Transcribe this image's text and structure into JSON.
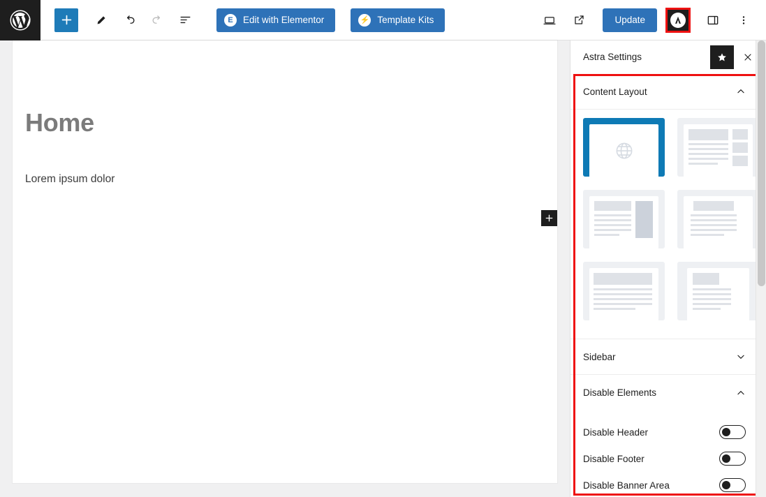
{
  "toolbar": {
    "logo_icon": "wordpress-logo-icon",
    "left_buttons": [
      {
        "name": "add-block-button",
        "icon": "plus-icon",
        "label": ""
      },
      {
        "name": "edit-tool-button",
        "icon": "pencil-icon",
        "label": ""
      },
      {
        "name": "undo-button",
        "icon": "undo-arrow-icon",
        "label": ""
      },
      {
        "name": "redo-button",
        "icon": "redo-arrow-icon",
        "label": ""
      },
      {
        "name": "document-overview-button",
        "icon": "list-view-icon",
        "label": ""
      }
    ],
    "elementor_label": "Edit with Elementor",
    "elementor_icon": "elementor-logo-icon",
    "template_kits_label": "Template Kits",
    "template_kits_icon": "lightning-bolt-icon",
    "preview_icon": "desktop-preview-icon",
    "view_icon": "external-link-icon",
    "update_label": "Update",
    "astra_icon": "astra-logo-icon",
    "sidebar_icon": "settings-sidebar-icon",
    "more_icon": "three-dots-vertical-icon"
  },
  "editor": {
    "post_title": "Home",
    "paragraph": "Lorem ipsum dolor",
    "appender_icon": "plus-icon"
  },
  "panel": {
    "title": "Astra Settings",
    "star_icon": "star-icon",
    "close_icon": "close-x-icon",
    "sections": {
      "content_layout": {
        "label": "Content Layout",
        "expanded": true,
        "chevron": "chevron-up-icon",
        "options": [
          {
            "name": "layout-default",
            "selected": true,
            "thumb": "globe"
          },
          {
            "name": "layout-narrow-sidebar-right-blocks",
            "selected": false,
            "thumb": "right-blocks"
          },
          {
            "name": "layout-content-with-right-sidebar",
            "selected": false,
            "thumb": "right-sidebar"
          },
          {
            "name": "layout-narrow-content",
            "selected": false,
            "thumb": "narrow-content"
          },
          {
            "name": "layout-full-width-contained",
            "selected": false,
            "thumb": "full-contained"
          },
          {
            "name": "layout-full-width-stretched",
            "selected": false,
            "thumb": "full-stretched"
          }
        ]
      },
      "sidebar": {
        "label": "Sidebar",
        "expanded": false,
        "chevron": "chevron-down-icon"
      },
      "disable_elements": {
        "label": "Disable Elements",
        "expanded": true,
        "chevron": "chevron-up-icon",
        "toggles": [
          {
            "label": "Disable Header",
            "name": "toggle-disable-header",
            "on": false
          },
          {
            "label": "Disable Footer",
            "name": "toggle-disable-footer",
            "on": false
          },
          {
            "label": "Disable Banner Area",
            "name": "toggle-disable-banner-area",
            "on": false
          }
        ]
      }
    }
  },
  "colors": {
    "accent_blue": "#2e72b8",
    "selected_blue": "#0e7ab5",
    "highlight_red": "#ee1111",
    "dark": "#1e1e1e",
    "canvas_bg": "#f0f0f1"
  }
}
